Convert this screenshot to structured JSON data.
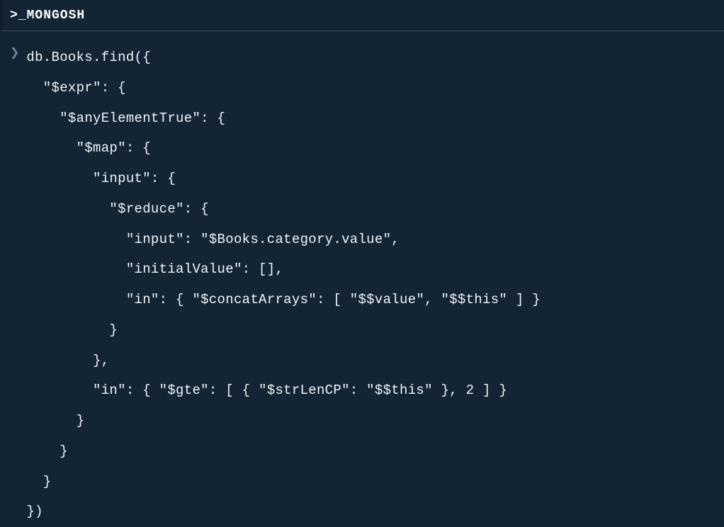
{
  "header": {
    "title": ">_MONGOSH"
  },
  "shell": {
    "prompt_glyph": "❯",
    "code": "db.Books.find({\n  \"$expr\": {\n    \"$anyElementTrue\": {\n      \"$map\": {\n        \"input\": {\n          \"$reduce\": {\n            \"input\": \"$Books.category.value\",\n            \"initialValue\": [],\n            \"in\": { \"$concatArrays\": [ \"$$value\", \"$$this\" ] }\n          }\n        },\n        \"in\": { \"$gte\": [ { \"$strLenCP\": \"$$this\" }, 2 ] }\n      }\n    }\n  }\n})"
  }
}
